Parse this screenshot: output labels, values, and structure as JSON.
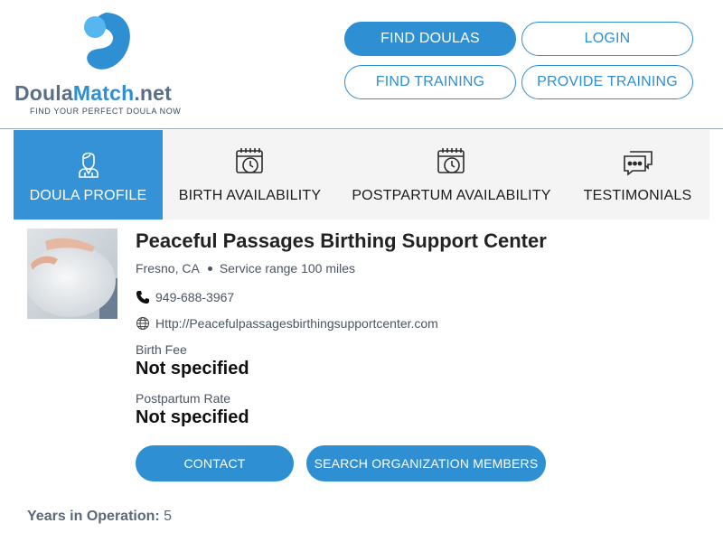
{
  "logo": {
    "name_part1": "Doula",
    "name_part2": "Match",
    "name_part3": ".net",
    "tagline": "FIND YOUR PERFECT DOULA NOW"
  },
  "nav": {
    "find_doulas": "FIND DOULAS",
    "login": "LOGIN",
    "find_training": "FIND TRAINING",
    "provide_training": "PROVIDE TRAINING"
  },
  "tabs": [
    {
      "label": "DOULA PROFILE",
      "icon": "doula-person-icon",
      "active": true
    },
    {
      "label": "BIRTH AVAILABILITY",
      "icon": "calendar-clock-icon",
      "active": false
    },
    {
      "label": "POSTPARTUM AVAILABILITY",
      "icon": "calendar-clock-icon",
      "active": false
    },
    {
      "label": "TESTIMONIALS",
      "icon": "chat-bubbles-icon",
      "active": false
    }
  ],
  "profile": {
    "name": "Peaceful Passages Birthing Support Center",
    "city": "Fresno, CA",
    "service_range": "Service range 100 miles",
    "phone": "949-688-3967",
    "website": "Http://Peacefulpassagesbirthingsupportcenter.com",
    "birth_fee_label": "Birth Fee",
    "birth_fee_value": "Not specified",
    "postpartum_rate_label": "Postpartum Rate",
    "postpartum_rate_value": "Not specified",
    "contact_button": "CONTACT",
    "search_org_button": "SEARCH ORGANIZATION MEMBERS",
    "years_label": "Years in Operation:",
    "years_value": "5"
  },
  "colors": {
    "accent": "#2f8fd3",
    "active_tab": "#3592d6",
    "tab_bg": "#f4f4f4"
  }
}
